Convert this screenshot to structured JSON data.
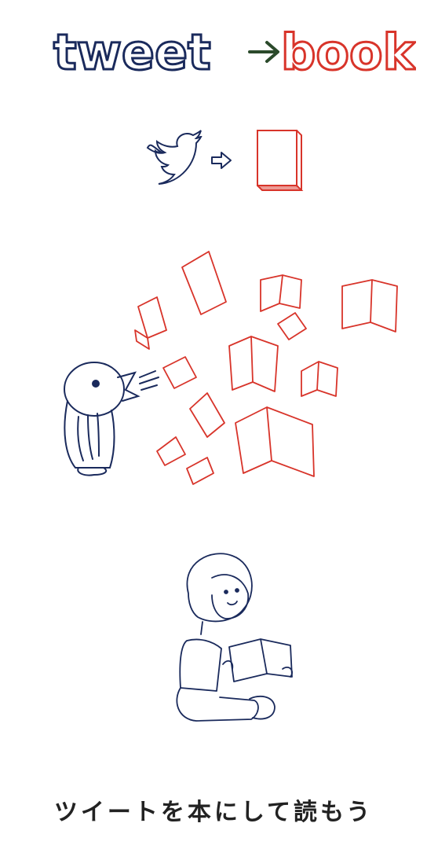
{
  "logo": {
    "word_left": "tweet",
    "word_right": "book",
    "color_left": "#1a2a5c",
    "color_right": "#d8342a",
    "arrow_color": "#2b4a2b"
  },
  "concept": {
    "from_icon": "twitter-bird-icon",
    "arrow_icon": "right-arrow-icon",
    "to_icon": "book-icon"
  },
  "illustration": {
    "bird_color": "#1a2a5c",
    "books_color": "#d8342a"
  },
  "tagline": "ツイートを本にして読もう"
}
